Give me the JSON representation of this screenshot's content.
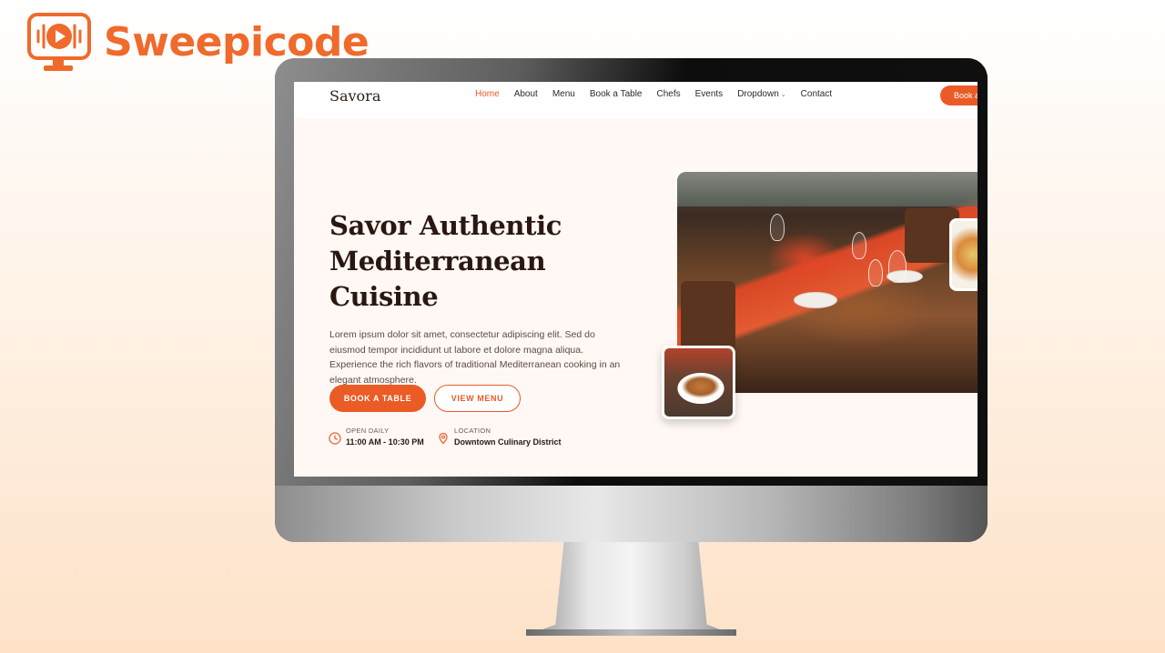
{
  "brand": {
    "name": "Sweepicode",
    "color": "#ef6a2b",
    "icon": "monitor-play-code-icon"
  },
  "site": {
    "logo": "Savora",
    "nav": {
      "links": [
        "Home",
        "About",
        "Menu",
        "Book a Table",
        "Chefs",
        "Events",
        "Dropdown",
        "Contact"
      ],
      "active": "Home",
      "cta": "Book a"
    },
    "hero": {
      "title": "Savor Authentic Mediterranean Cuisine",
      "description": "Lorem ipsum dolor sit amet, consectetur adipiscing elit. Sed do eiusmod tempor incididunt ut labore et dolore magna aliqua. Experience the rich flavors of traditional Mediterranean cooking in an elegant atmosphere.",
      "primary_button": "BOOK A TABLE",
      "secondary_button": "VIEW MENU",
      "hours": {
        "label": "OPEN DAILY",
        "value": "11:00 AM - 10:30 PM",
        "icon": "clock-icon"
      },
      "location": {
        "label": "LOCATION",
        "value": "Downtown Culinary District",
        "icon": "map-pin-icon"
      }
    },
    "accent_color": "#ea5b26"
  }
}
